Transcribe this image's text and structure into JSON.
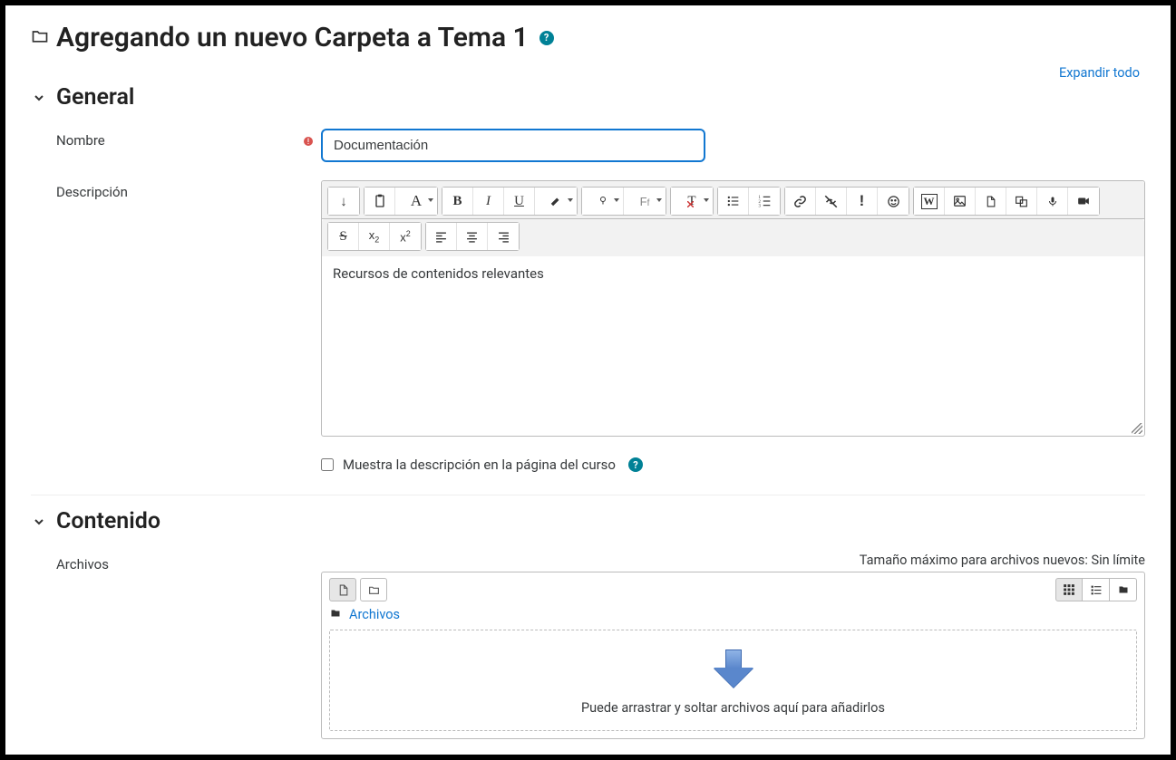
{
  "page": {
    "title": "Agregando un nuevo Carpeta a Tema 1",
    "expand_all": "Expandir todo"
  },
  "sections": {
    "general": {
      "title": "General"
    },
    "contenido": {
      "title": "Contenido"
    }
  },
  "general": {
    "name_label": "Nombre",
    "name_value": "Documentación",
    "desc_label": "Descripción",
    "desc_text": "Recursos de contenidos relevantes",
    "show_desc_label": "Muestra la descripción en la página del curso"
  },
  "editor_toolbar": {
    "toggle": "↓",
    "paste": "paste",
    "font_color": "A",
    "bold": "B",
    "italic": "I",
    "underline": "U",
    "highlight": "brush",
    "bulb": "bulb",
    "font_family": "Ff",
    "text_transform": "T",
    "list_ul": "ul",
    "list_ol": "ol",
    "link": "link",
    "unlink": "unlink",
    "warning": "!",
    "emoji": "☺",
    "wikipedia": "W",
    "image": "image",
    "file": "file",
    "embed": "embed",
    "mic": "mic",
    "video": "video",
    "strike": "S",
    "subscript": "x2",
    "superscript": "x2",
    "align_left": "al",
    "align_center": "ac",
    "align_right": "ar"
  },
  "content": {
    "files_label": "Archivos",
    "max_size_text": "Tamaño máximo para archivos nuevos: Sin límite",
    "breadcrumb": "Archivos",
    "dropzone_text": "Puede arrastrar y soltar archivos aquí para añadirlos"
  }
}
